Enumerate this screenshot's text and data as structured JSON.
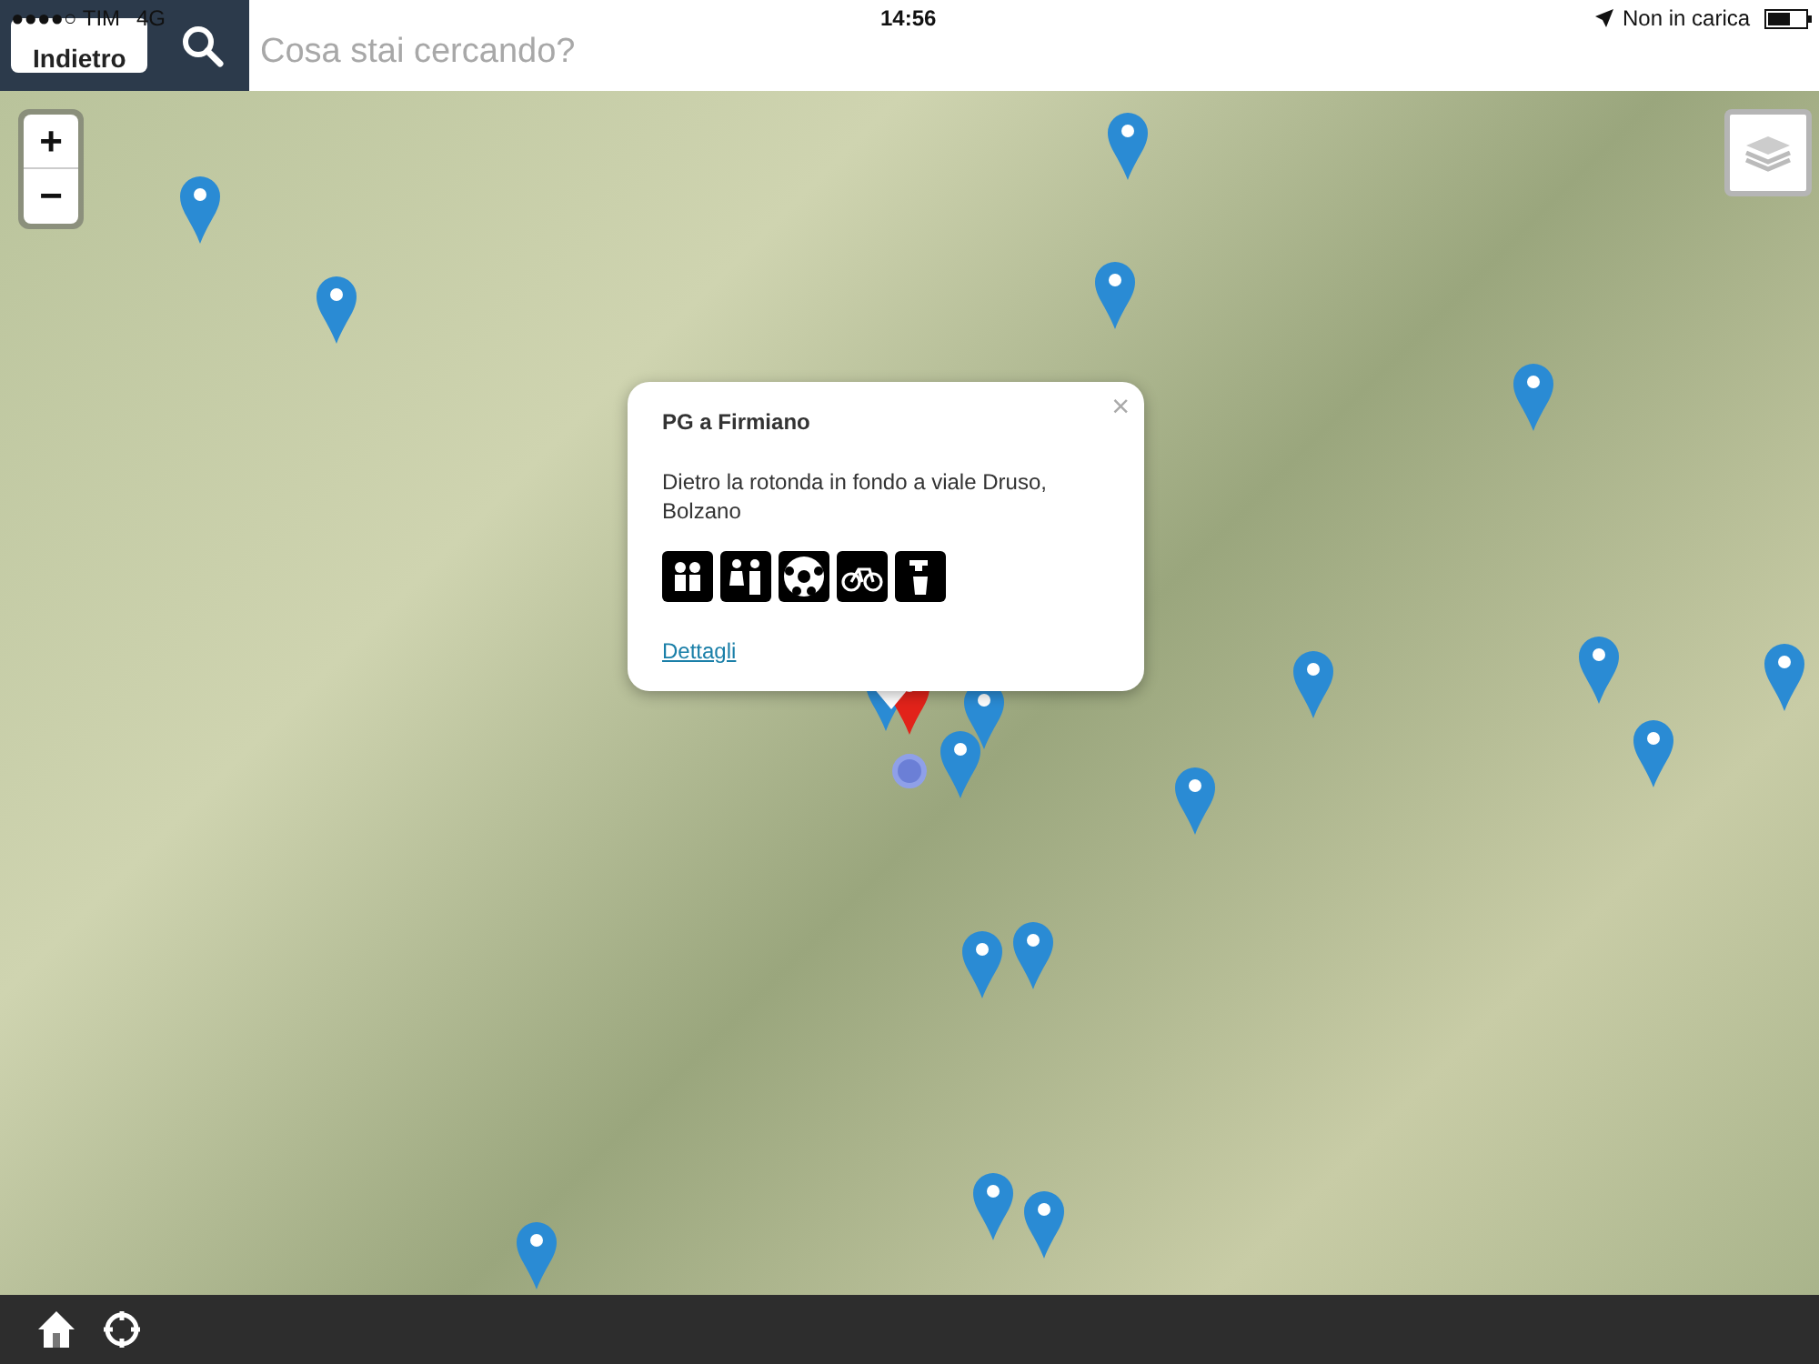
{
  "status_bar": {
    "carrier": "●●●●○ TIM",
    "network": "4G",
    "time": "14:56",
    "charging": "Non in carica"
  },
  "header": {
    "back_button": "Indietro",
    "search": {
      "placeholder": "Cosa stai cercando?"
    }
  },
  "map": {
    "zoom_in": "+",
    "zoom_out": "−",
    "popup": {
      "title": "PG a Firmiano",
      "address": "Dietro la rotonda in fondo a viale Druso, Bolzano",
      "close": "×",
      "link": "Dettagli"
    }
  }
}
